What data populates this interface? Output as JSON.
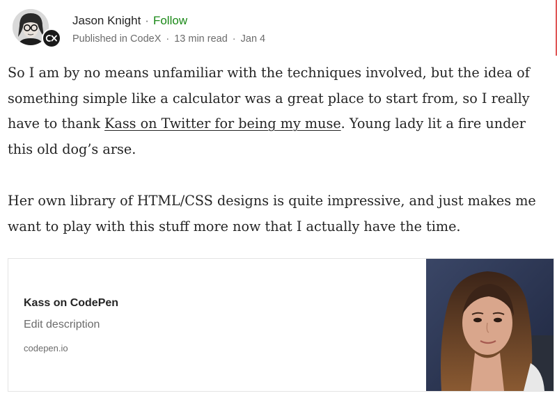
{
  "author": {
    "name": "Jason Knight",
    "follow_label": "Follow",
    "separator": "·"
  },
  "publication": {
    "prefix": "Published in",
    "name": "CodeX",
    "read_time": "13 min read",
    "date": "Jan 4"
  },
  "article": {
    "para1_part1": "So I am by no means unfamiliar with the techniques involved, but the idea of something simple like a calculator was a great place to start from, so I really have to thank ",
    "para1_link": "Kass on Twitter for being my muse",
    "para1_part2": ". Young lady lit a fire under this old dog’s arse.",
    "para2": "Her own library of HTML/CSS designs is quite impressive, and just makes me want to play with this stuff more now that I actually have the time."
  },
  "embed": {
    "title": "Kass on CodePen",
    "description": "Edit description",
    "domain": "codepen.io"
  },
  "icons": {
    "avatar": "author-avatar",
    "publication": "codex-logo-icon"
  },
  "colors": {
    "follow": "#1a8917",
    "text": "#242424",
    "muted": "#6b6b6b",
    "card_border": "#e3e3e3"
  }
}
